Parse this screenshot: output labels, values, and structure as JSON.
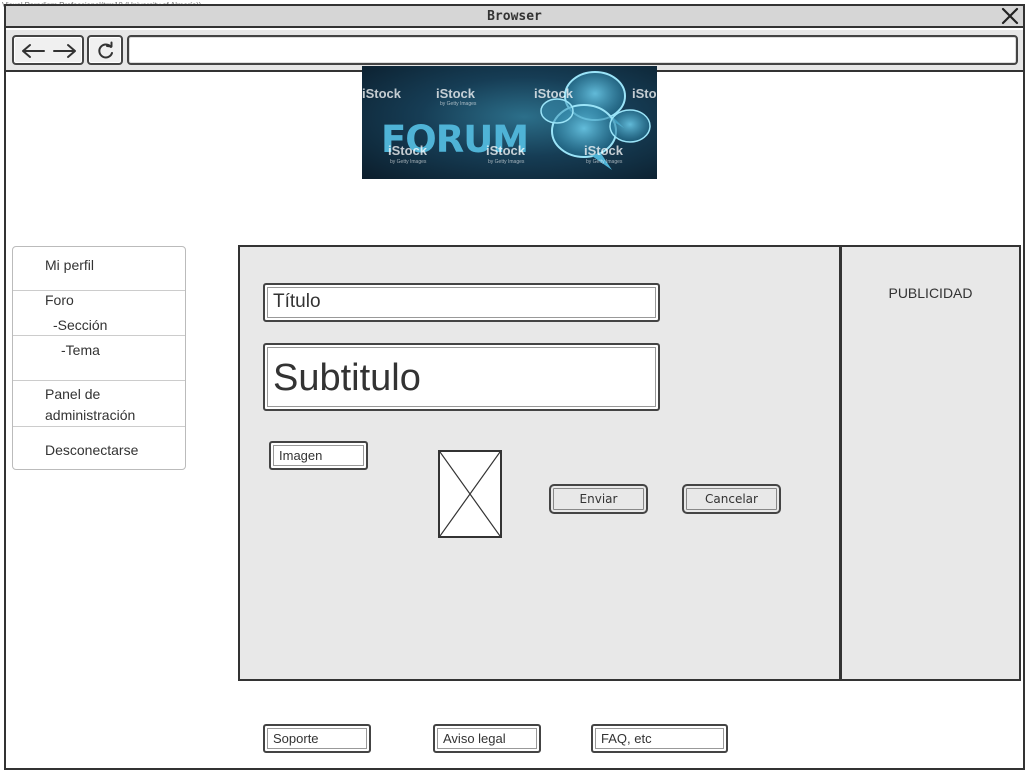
{
  "watermark": "Visual Paradigm Professional(trm18 (University of Almería))",
  "window": {
    "title": "Browser"
  },
  "toolbar": {
    "url": ""
  },
  "banner": {
    "word": "FORUM",
    "stock_marks": [
      "iStock",
      "iStock",
      "iStock",
      "iStock",
      "iStock",
      "iStock",
      "iStock"
    ],
    "stock_sub": "by Getty Images"
  },
  "sidebar": {
    "mi_perfil": "Mi perfil",
    "foro": "Foro",
    "seccion": "-Sección",
    "tema": "-Tema",
    "panel_line1": "Panel de",
    "panel_line2": "administración",
    "desconectarse": "Desconectarse"
  },
  "form": {
    "titulo": "Título",
    "subtitulo": "Subtitulo",
    "imagen": "Imagen",
    "enviar": "Enviar",
    "cancelar": "Cancelar"
  },
  "ads": {
    "label": "PUBLICIDAD"
  },
  "footer": {
    "soporte": "Soporte",
    "aviso_legal": "Aviso legal",
    "faq": "FAQ, etc"
  },
  "colors": {
    "panel_bg": "#e8e8e8",
    "border": "#333333",
    "banner_dark": "#0b1d2b",
    "banner_light": "#4fb3d6"
  },
  "icons": [
    "close-icon",
    "arrow-left-icon",
    "arrow-right-icon",
    "reload-icon",
    "image-placeholder-icon",
    "speech-bubbles-icon"
  ]
}
